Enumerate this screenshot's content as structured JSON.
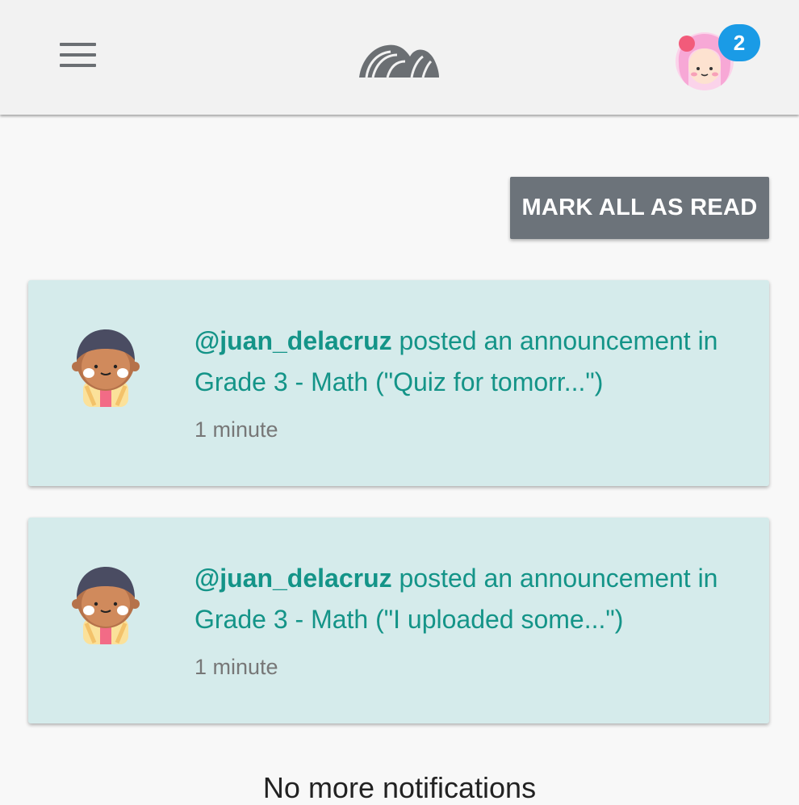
{
  "header": {
    "menu_icon": "hamburger-menu-icon",
    "logo_icon": "shell-logo-icon",
    "notification_count": "2"
  },
  "actions": {
    "mark_all_read_label": "MARK ALL AS READ"
  },
  "notifications": [
    {
      "user": "@juan_delacruz",
      "text": " posted an announcement in Grade 3 - Math (\"Quiz for tomorr...\")",
      "time": "1 minute"
    },
    {
      "user": "@juan_delacruz",
      "text": " posted an announcement in Grade 3 - Math (\"I uploaded some...\")",
      "time": "1 minute"
    }
  ],
  "footer": {
    "end_text": "No more notifications"
  },
  "colors": {
    "accent": "#149488",
    "badge": "#1a9be6",
    "card_bg": "#d5ebeb",
    "button_bg": "#6c737a"
  }
}
